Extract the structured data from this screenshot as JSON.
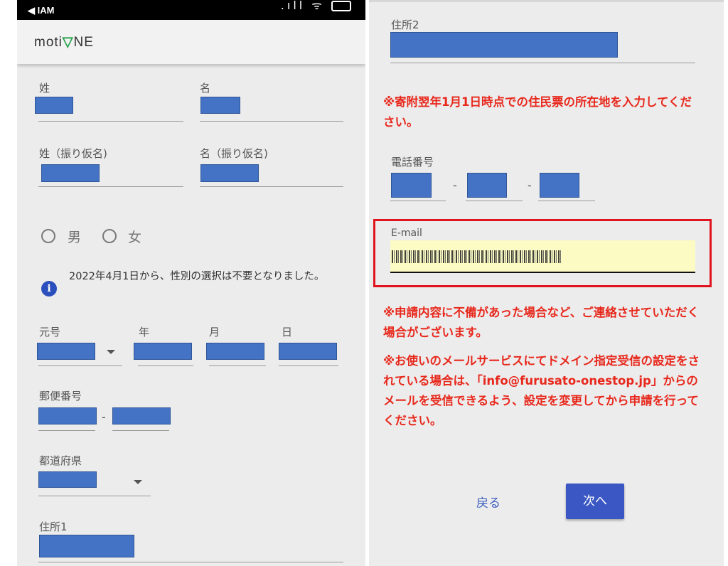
{
  "status_bar": {
    "carrier": "◀ IAM",
    "signal_icon": "signal-icon",
    "wifi_icon": "wifi-icon",
    "battery_icon": "battery-icon"
  },
  "app": {
    "logo_prefix": "moti",
    "logo_mark": "▽",
    "logo_suffix": "NE"
  },
  "left_form": {
    "last_name_label": "姓",
    "first_name_label": "名",
    "last_name_kana_label": "姓（振り仮名)",
    "first_name_kana_label": "名（振り仮名)",
    "gender_male": "男",
    "gender_female": "女",
    "gender_note": "2022年4月1日から、性別の選択は不要となりました。",
    "era_label": "元号",
    "year_label": "年",
    "month_label": "月",
    "day_label": "日",
    "postal_label": "郵便番号",
    "postal_sep": "-",
    "prefecture_label": "都道府県",
    "address1_label": "住所1"
  },
  "right_form": {
    "address2_label": "住所2",
    "address_notice": "※寄附翌年1月1日時点での住民票の所在地を入力してください。",
    "phone_label": "電話番号",
    "phone_sep": "-",
    "email_label": "E-mail",
    "notice_contact": "※申請内容に不備があった場合など、ご連絡させていただく場合がございます。",
    "notice_mail": "※お使いのメールサービスにてドメイン指定受信の設定をされている場合は、「info@furusato-onestop.jp」からのメールを受信できるよう、設定を変更してから申請を行ってください。",
    "back_button": "戻る",
    "next_button": "次へ"
  },
  "colors": {
    "accent": "#3a57c4",
    "notice_red": "#e8281c",
    "highlight_border": "#e0141e",
    "redaction_blue": "#4472c4",
    "autofill_yellow": "#fbfbc3"
  }
}
